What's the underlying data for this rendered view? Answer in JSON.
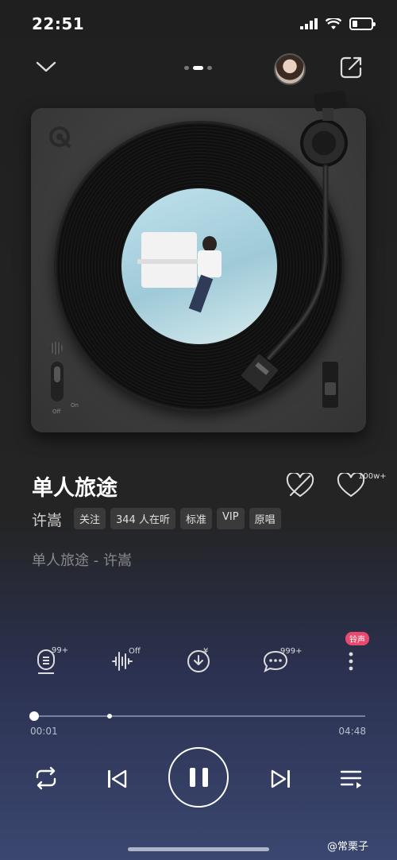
{
  "status_bar": {
    "time": "22:51"
  },
  "song": {
    "title": "单人旅途",
    "artist": "许嵩",
    "tags": [
      "关注",
      "344 人在听",
      "标准",
      "VIP",
      "原唱"
    ],
    "lyric_line": "单人旅途 - 许嵩",
    "like_count": "100w+"
  },
  "actions": {
    "comment_badge_left": "99+",
    "effect_badge": "Off",
    "comments_badge": "999+",
    "ringtone_label": "铃声"
  },
  "progress": {
    "current_time": "00:01",
    "total_time": "04:48",
    "played_fraction": 0.0035
  },
  "pager": {
    "pages": 3,
    "active": 1
  },
  "watermark": "@常栗子",
  "deck_labels": {
    "off": "Off",
    "on": "On"
  },
  "colors": {
    "accent_pink": "#e84a6f",
    "bg_top": "#1f1f1f",
    "bg_bottom": "#3b4770"
  }
}
